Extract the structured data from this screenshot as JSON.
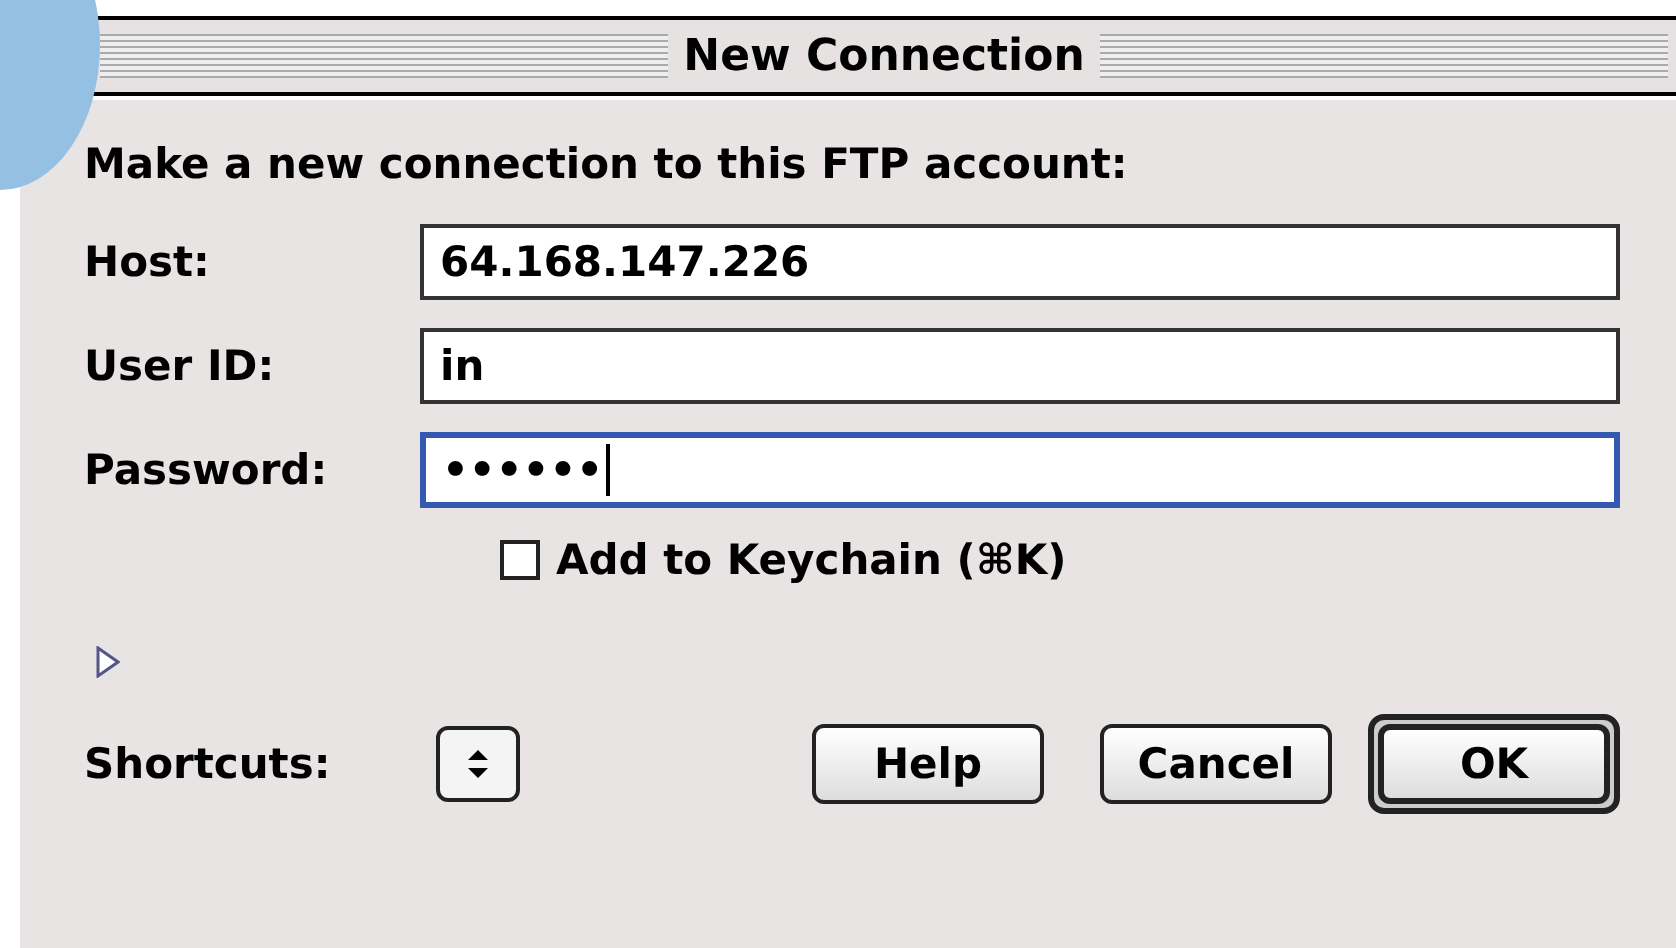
{
  "window": {
    "title": "New Connection"
  },
  "prompt": "Make a new connection to this FTP account:",
  "fields": [
    {
      "label": "Host:",
      "value": "64.168.147.226",
      "focused": false
    },
    {
      "label": "User ID:",
      "value": "in",
      "focused": false
    },
    {
      "label": "Password:",
      "value": "••••••",
      "focused": true
    }
  ],
  "keychain": {
    "label": "Add to Keychain (⌘K)",
    "checked": false
  },
  "disclosure": {
    "expanded": false
  },
  "shortcuts": {
    "label": "Shortcuts:"
  },
  "buttons": [
    {
      "label": "Help",
      "default": false
    },
    {
      "label": "Cancel",
      "default": false
    },
    {
      "label": "OK",
      "default": true
    }
  ]
}
